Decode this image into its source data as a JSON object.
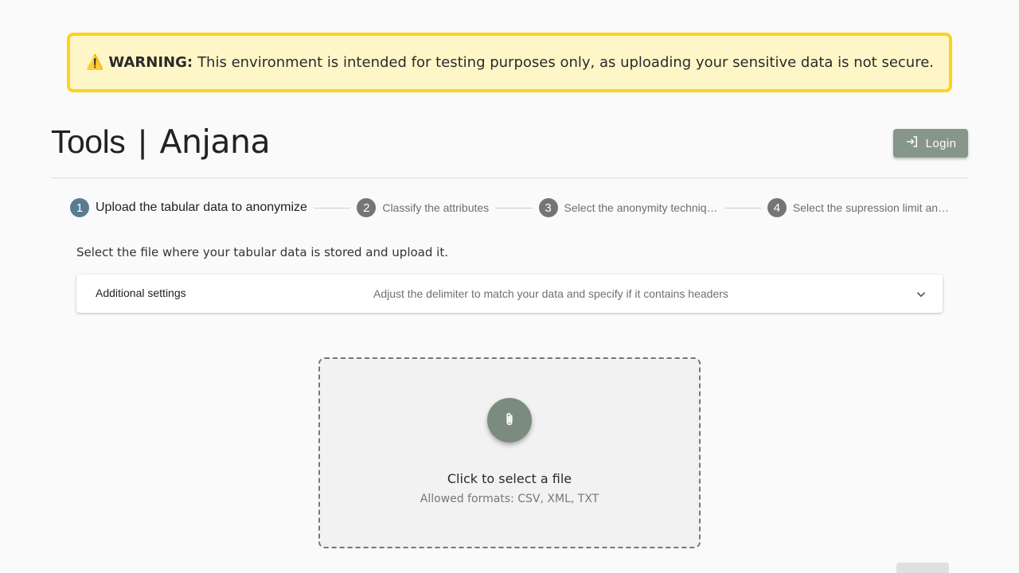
{
  "warning": {
    "icon": "warning-icon",
    "label": "WARNING:",
    "message": "This environment is intended for testing purposes only, as uploading your sensitive data is not secure.",
    "bg_color": "#fff6c8",
    "border_color": "#ffd21e"
  },
  "header": {
    "brand_prefix": "Tools",
    "brand_separator": "|",
    "brand_name": "Anjana",
    "login_label": "Login",
    "login_icon": "login-icon",
    "accent_color": "#869689"
  },
  "stepper": {
    "steps": [
      {
        "number": "1",
        "label": "Upload the tabular data to anonymize",
        "active": true
      },
      {
        "number": "2",
        "label": "Classify the attributes",
        "active": false
      },
      {
        "number": "3",
        "label": "Select the anonymity techniq…",
        "active": false
      },
      {
        "number": "4",
        "label": "Select the supression limit an…",
        "active": false
      }
    ],
    "active_color": "#587d93"
  },
  "instruction": "Select the file where your tabular data is stored and upload it.",
  "accordion": {
    "title": "Additional settings",
    "description": "Adjust the delimiter to match your data and specify if it contains headers",
    "icon": "chevron-down-icon"
  },
  "dropzone": {
    "icon": "paperclip-icon",
    "title": "Click to select a file",
    "formats": "Allowed formats: CSV, XML, TXT"
  }
}
